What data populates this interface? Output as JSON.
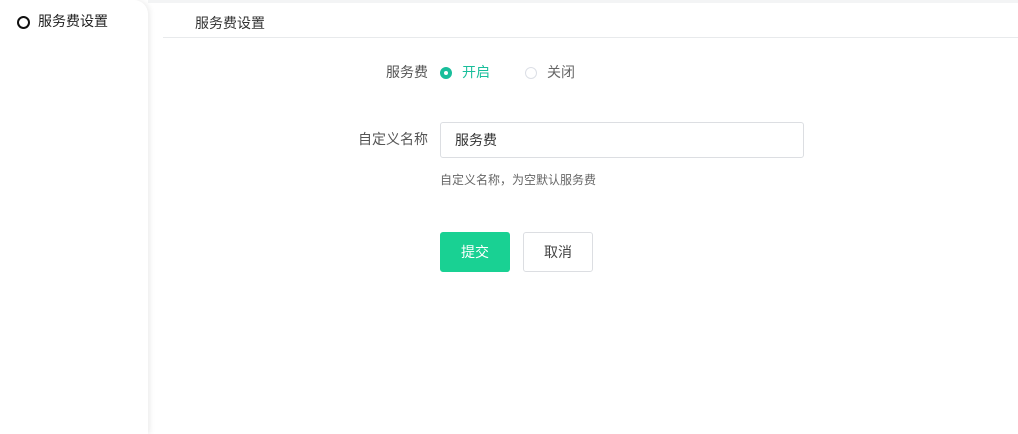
{
  "sidebar": {
    "items": [
      {
        "label": "服务费设置",
        "active": true
      }
    ]
  },
  "page": {
    "title": "服务费设置"
  },
  "form": {
    "service_fee": {
      "label": "服务费",
      "options": [
        {
          "label": "开启",
          "checked": true
        },
        {
          "label": "关闭",
          "checked": false
        }
      ]
    },
    "custom_name": {
      "label": "自定义名称",
      "value": "服务费",
      "help": "自定义名称，为空默认服务费"
    },
    "submit_label": "提交",
    "cancel_label": "取消"
  },
  "colors": {
    "accent": "#19be9b",
    "submit_button": "#19d193"
  }
}
